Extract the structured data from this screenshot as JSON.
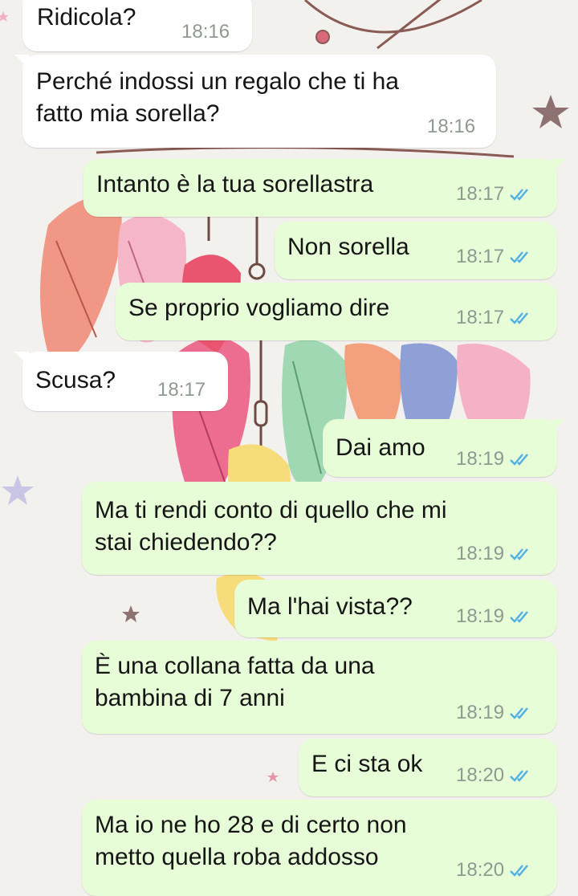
{
  "colors": {
    "incoming_bubble": "#ffffff",
    "outgoing_bubble": "#e7fdd8",
    "timestamp": "#8e9a8f",
    "read_ticks": "#4fb0e6"
  },
  "messages": [
    {
      "direction": "incoming",
      "text": "Ridicola?",
      "time": "18:16"
    },
    {
      "direction": "incoming",
      "text": "Perché indossi un regalo che ti ha\nfatto mia sorella?",
      "time": "18:16"
    },
    {
      "direction": "outgoing",
      "text": "Intanto è la tua sorellastra",
      "time": "18:17",
      "status": "read"
    },
    {
      "direction": "outgoing",
      "text": "Non sorella",
      "time": "18:17",
      "status": "read"
    },
    {
      "direction": "outgoing",
      "text": "Se proprio vogliamo dire",
      "time": "18:17",
      "status": "read"
    },
    {
      "direction": "incoming",
      "text": "Scusa?",
      "time": "18:17"
    },
    {
      "direction": "outgoing",
      "text": "Dai amo",
      "time": "18:19",
      "status": "read"
    },
    {
      "direction": "outgoing",
      "text": "Ma ti rendi conto di quello che mi\nstai chiedendo??",
      "time": "18:19",
      "status": "read"
    },
    {
      "direction": "outgoing",
      "text": "Ma l'hai vista??",
      "time": "18:19",
      "status": "read"
    },
    {
      "direction": "outgoing",
      "text": "È una collana fatta da una\nbambina di 7 anni",
      "time": "18:19",
      "status": "read"
    },
    {
      "direction": "outgoing",
      "text": "E ci sta ok",
      "time": "18:20",
      "status": "read"
    },
    {
      "direction": "outgoing",
      "text": "Ma io ne ho 28 e di certo non\nmetto quella roba addosso",
      "time": "18:20",
      "status": "read"
    }
  ]
}
